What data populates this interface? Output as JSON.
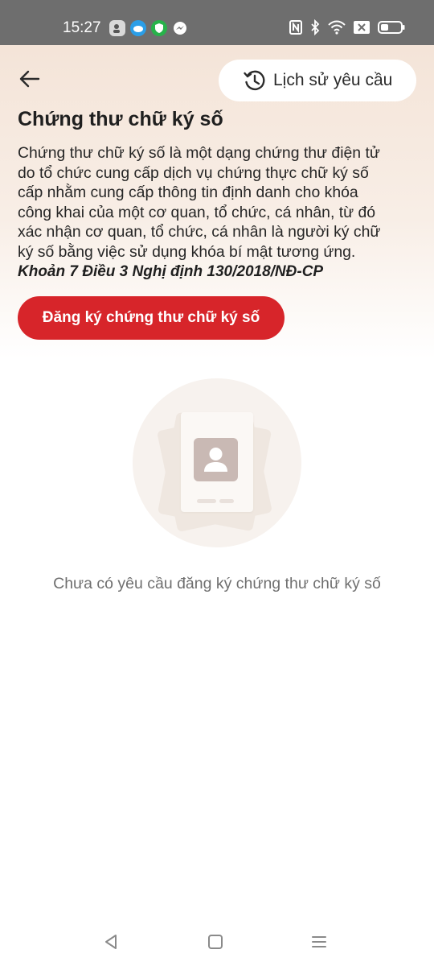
{
  "status_bar": {
    "time": "15:27",
    "left_icons": [
      "contact-card-icon",
      "cloud-icon",
      "shield-icon",
      "messenger-icon"
    ],
    "right_icons": [
      "nfc-icon",
      "bluetooth-icon",
      "wifi-icon",
      "sim-off-icon",
      "battery-icon"
    ]
  },
  "header": {
    "back_icon": "back-arrow-icon",
    "history_button": {
      "icon": "history-clock-icon",
      "label": "Lịch sử yêu cầu"
    }
  },
  "content": {
    "title": "Chứng thư chữ ký số",
    "description_lines": [
      "Chứng thư chữ ký số là một dạng chứng thư điện tử",
      "do tổ chức cung cấp dịch vụ chứng thực chữ ký số",
      "cấp nhằm cung cấp thông tin định danh cho khóa",
      "công khai của một cơ quan, tổ chức, cá nhân, từ đó",
      "xác nhận cơ quan, tổ chức, cá nhân là người ký chữ",
      "ký số bằng việc sử dụng khóa bí mật tương ứng."
    ],
    "legal_reference": "Khoản 7 Điều 3 Nghị định 130/2018/NĐ-CP",
    "register_button_label": "Đăng ký chứng thư chữ ký số"
  },
  "empty_state": {
    "illustration": "document-avatar-illustration",
    "message": "Chưa có yêu cầu đăng ký chứng thư chữ ký số"
  },
  "nav_bar": {
    "items": [
      "back-triangle-icon",
      "home-square-icon",
      "recents-menu-icon"
    ]
  },
  "colors": {
    "accent": "#d7252a",
    "hero_top": "#f4e4d8",
    "status_bar": "#6e6e6e",
    "empty_text": "#6f6f6f"
  }
}
